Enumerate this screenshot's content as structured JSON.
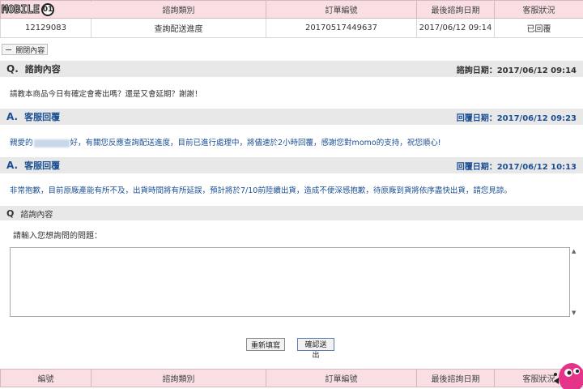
{
  "logo": {
    "text": "MOBILE",
    "circle": "01"
  },
  "top_table": {
    "headers": [
      "",
      "諮詢類別",
      "訂單編號",
      "最後諮詢日期",
      "客服狀況"
    ],
    "row": [
      "12129083",
      "查詢配送進度",
      "20170517449637",
      "2017/06/12 09:14",
      "已回覆"
    ]
  },
  "toggle": {
    "label": "關閉內容",
    "symbol": "−"
  },
  "question": {
    "letter": "Q.",
    "title": "諮詢內容",
    "date": "諮詢日期：2017/06/12 09:14",
    "text": "請教本商品今日有確定會寄出嗎？還是又會延期？謝謝！"
  },
  "answer1": {
    "letter": "A.",
    "title": "客服回覆",
    "date": "回覆日期：2017/06/12 09:23",
    "prefix": "親愛的",
    "text": "好，有關您反應查詢配送進度，目前已進行處理中，將儘速於2小時回覆，感謝您對momo的支持，祝您順心!"
  },
  "answer2": {
    "letter": "A.",
    "title": "客服回覆",
    "date": "回覆日期：2017/06/12 10:13",
    "text": "非常抱歉，目前原廠產能有所不及，出貨時間將有所延誤，預計將於7/10前陸續出貨，造成不便深感抱歉，待原廠到貨將依序盡快出貨，請您見諒。"
  },
  "ask": {
    "letter": "Q",
    "title": "諮詢內容",
    "prompt": "請輸入您想詢問的問題：",
    "input_value": ""
  },
  "buttons": {
    "reset": "重新填寫",
    "submit": "確認送出"
  },
  "bottom_table": {
    "headers": [
      "編號",
      "諮詢類別",
      "訂單編號",
      "最後諮詢日期",
      "客服狀況"
    ]
  },
  "colors": {
    "header_pink": "#f9dfe4",
    "bar_gray": "#e8e8e8",
    "answer_blue": "#1a4f93"
  }
}
